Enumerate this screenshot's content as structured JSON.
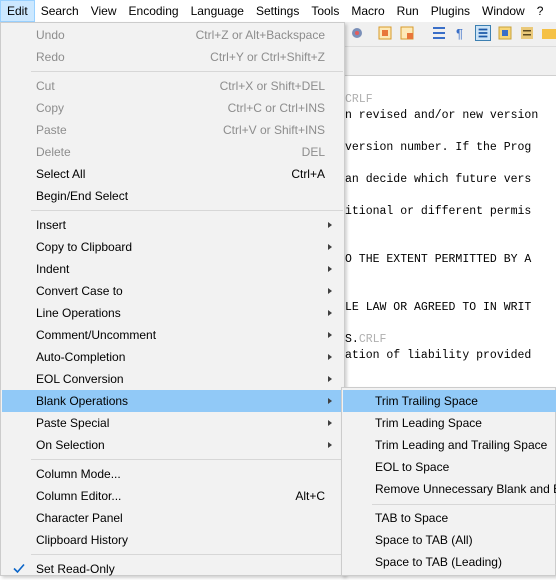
{
  "menubar": [
    "Edit",
    "Search",
    "View",
    "Encoding",
    "Language",
    "Settings",
    "Tools",
    "Macro",
    "Run",
    "Plugins",
    "Window",
    "?"
  ],
  "editor_lines": [
    {
      "text": "",
      "crlf": "CRLF"
    },
    {
      "text": "n revised and/or new version"
    },
    {
      "text": "version number. If the Prog"
    },
    {
      "text": "an decide which future vers"
    },
    {
      "text": "itional or different permis"
    },
    {
      "text": "O THE EXTENT PERMITTED BY A"
    },
    {
      "text": "LE LAW OR AGREED TO IN WRIT"
    },
    {
      "text": "S.",
      "crlf": "CRLF"
    },
    {
      "text": "ation of liability provided"
    }
  ],
  "edit_menu": {
    "undo": {
      "label": "Undo",
      "shortcut": "Ctrl+Z or Alt+Backspace"
    },
    "redo": {
      "label": "Redo",
      "shortcut": "Ctrl+Y or Ctrl+Shift+Z"
    },
    "cut": {
      "label": "Cut",
      "shortcut": "Ctrl+X or Shift+DEL"
    },
    "copy": {
      "label": "Copy",
      "shortcut": "Ctrl+C or Ctrl+INS"
    },
    "paste": {
      "label": "Paste",
      "shortcut": "Ctrl+V or Shift+INS"
    },
    "delete": {
      "label": "Delete",
      "shortcut": "DEL"
    },
    "select_all": {
      "label": "Select All",
      "shortcut": "Ctrl+A"
    },
    "begin_end_select": {
      "label": "Begin/End Select"
    },
    "insert": {
      "label": "Insert"
    },
    "copy_to_clipboard": {
      "label": "Copy to Clipboard"
    },
    "indent": {
      "label": "Indent"
    },
    "convert_case": {
      "label": "Convert Case to"
    },
    "line_operations": {
      "label": "Line Operations"
    },
    "comment": {
      "label": "Comment/Uncomment"
    },
    "auto_completion": {
      "label": "Auto-Completion"
    },
    "eol_conversion": {
      "label": "EOL Conversion"
    },
    "blank_operations": {
      "label": "Blank Operations"
    },
    "paste_special": {
      "label": "Paste Special"
    },
    "on_selection": {
      "label": "On Selection"
    },
    "column_mode": {
      "label": "Column Mode..."
    },
    "column_editor": {
      "label": "Column Editor...",
      "shortcut": "Alt+C"
    },
    "character_panel": {
      "label": "Character Panel"
    },
    "clipboard_history": {
      "label": "Clipboard History"
    },
    "set_read_only": {
      "label": "Set Read-Only"
    }
  },
  "blank_submenu": {
    "trim_trailing": "Trim Trailing Space",
    "trim_leading": "Trim Leading Space",
    "trim_both": "Trim Leading and Trailing Space",
    "eol_to_space": "EOL to Space",
    "remove_unnecessary": "Remove Unnecessary Blank and EOL",
    "tab_to_space": "TAB to Space",
    "space_to_tab_all": "Space to TAB (All)",
    "space_to_tab_leading": "Space to TAB (Leading)"
  },
  "colors": {
    "highlight": "#91c9f7",
    "menu_bg": "#f2f2f2",
    "disabled": "#8d8d8d",
    "check": "#0a64c8"
  }
}
